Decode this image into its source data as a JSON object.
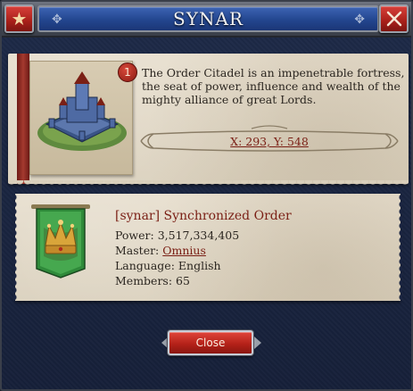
{
  "window": {
    "title": "SYNAR"
  },
  "header": {
    "star_icon": "star-icon",
    "close_icon": "close-x-icon",
    "ornament": "✥"
  },
  "citadel": {
    "level": "1",
    "description": "The Order Citadel is an impenetrable fortress, the seat of power, influence and wealth of the mighty alliance of great Lords.",
    "coordinates": "X: 293, Y: 548"
  },
  "order": {
    "name": "[synar] Synchronized Order",
    "power_label": "Power:",
    "power_value": "3,517,334,405",
    "master_label": "Master:",
    "master_value": "Omnius",
    "language_label": "Language:",
    "language_value": "English",
    "members_label": "Members:",
    "members_value": "65"
  },
  "footer": {
    "close_label": "Close"
  },
  "colors": {
    "title_blue": "#23468f",
    "accent_red": "#b52219",
    "parchment": "#e6ddcc",
    "link_red": "#7a1f15"
  }
}
